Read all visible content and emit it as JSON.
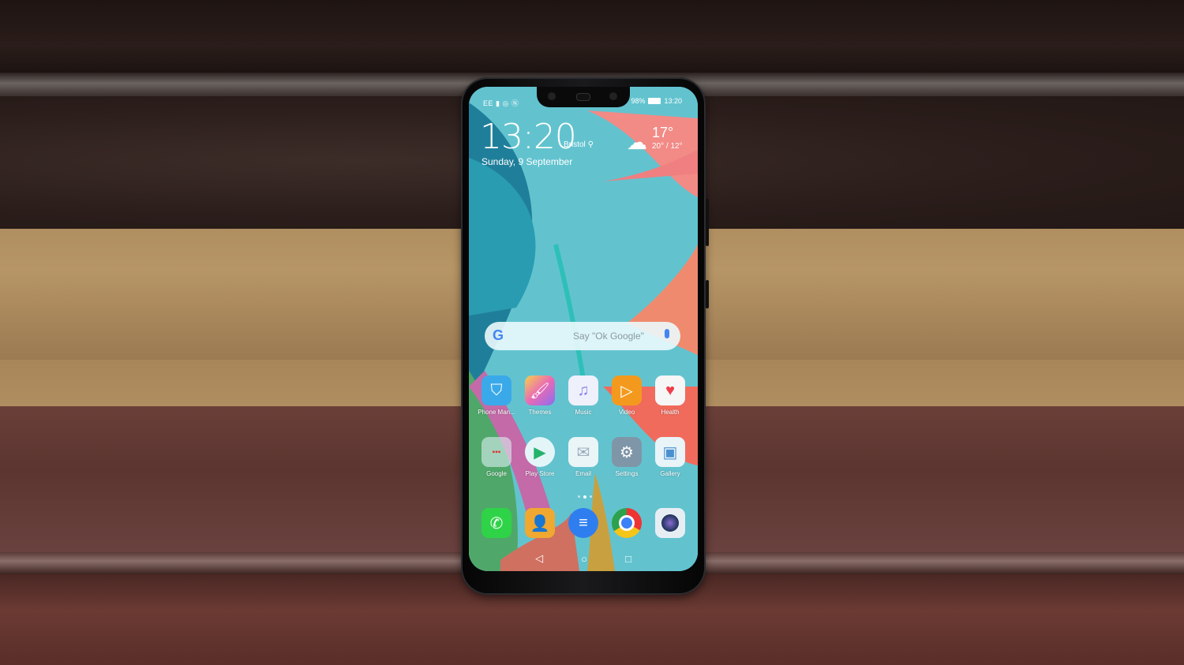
{
  "scene": {
    "description": "Smartphone standing against a wooden park bench with autumn leaves in background",
    "colors": {
      "bench_top": "#231816",
      "bench_lower": "#5c3530",
      "leaves": "#b69566",
      "phone_body": "#0a0a0a"
    }
  },
  "phone": {
    "status_bar": {
      "carrier": "EE",
      "left_icons": [
        "signal-icon",
        "wifi-icon",
        "nfc-icon"
      ],
      "battery": "98%",
      "time": "13:20"
    },
    "lockclock": {
      "time": "13:20",
      "city": "Bristol",
      "date": "Sunday, 9 September"
    },
    "weather": {
      "icon": "partly-cloudy-icon",
      "temp": "17°",
      "range": "20° / 12°"
    },
    "search": {
      "logo": "G",
      "placeholder": "Say \"Ok Google\""
    },
    "apps_row1": [
      {
        "label": "Phone Man...",
        "icon": "shield-icon",
        "color": "#3aa9ea"
      },
      {
        "label": "Themes",
        "icon": "brush-icon",
        "color": "#e96bb5"
      },
      {
        "label": "Music",
        "icon": "music-icon",
        "color": "#a99ef0"
      },
      {
        "label": "Video",
        "icon": "play-icon",
        "color": "#f39a1e"
      },
      {
        "label": "Health",
        "icon": "heart-icon",
        "color": "#f6f6f6"
      }
    ],
    "apps_row2": [
      {
        "label": "Google",
        "icon": "folder-icon",
        "color": "#dfeef0"
      },
      {
        "label": "Play Store",
        "icon": "play-store-icon",
        "color": "#e4f5f8"
      },
      {
        "label": "Email",
        "icon": "mail-icon",
        "color": "#eaf5f8"
      },
      {
        "label": "Settings",
        "icon": "gear-icon",
        "color": "#7f96a8"
      },
      {
        "label": "Gallery",
        "icon": "image-icon",
        "color": "#e8f4f8"
      }
    ],
    "dock": [
      {
        "label": "Phone",
        "icon": "phone-icon",
        "color": "#2fd348"
      },
      {
        "label": "Contacts",
        "icon": "contact-icon",
        "color": "#f0a830"
      },
      {
        "label": "Messages",
        "icon": "message-icon",
        "color": "#2f7ef0"
      },
      {
        "label": "Chrome",
        "icon": "chrome-icon",
        "color": "#ffffff"
      },
      {
        "label": "Camera",
        "icon": "camera-icon",
        "color": "#e6eef4"
      }
    ],
    "page_indicator": {
      "pages": 3,
      "active": 2
    },
    "nav_bar": [
      "back-icon",
      "home-icon",
      "recents-icon"
    ]
  }
}
